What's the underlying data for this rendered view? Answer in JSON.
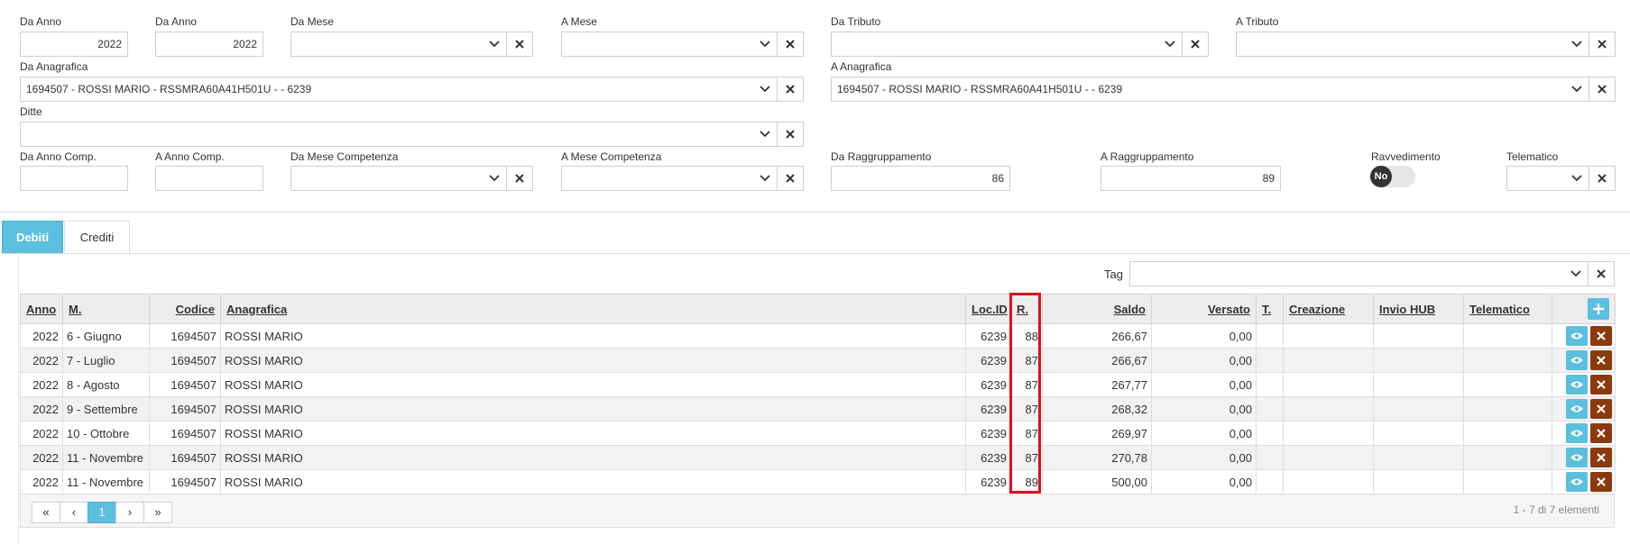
{
  "filters": {
    "da_anno": {
      "label": "Da Anno",
      "value": "2022"
    },
    "a_anno": {
      "label": "Da Anno",
      "value": "2022"
    },
    "da_mese": {
      "label": "Da Mese",
      "value": ""
    },
    "a_mese": {
      "label": "A Mese",
      "value": ""
    },
    "da_tributo": {
      "label": "Da Tributo",
      "value": ""
    },
    "a_tributo": {
      "label": "A Tributo",
      "value": ""
    },
    "da_anagrafica": {
      "label": "Da Anagrafica",
      "value": "1694507 - ROSSI MARIO - RSSMRA60A41H501U - - 6239"
    },
    "a_anagrafica": {
      "label": "A Anagrafica",
      "value": "1694507 - ROSSI MARIO - RSSMRA60A41H501U - - 6239"
    },
    "ditte": {
      "label": "Ditte",
      "value": ""
    },
    "da_anno_comp": {
      "label": "Da Anno Comp.",
      "value": ""
    },
    "a_anno_comp": {
      "label": "A Anno Comp.",
      "value": ""
    },
    "da_mese_comp": {
      "label": "Da Mese Competenza",
      "value": ""
    },
    "a_mese_comp": {
      "label": "A Mese Competenza",
      "value": ""
    },
    "da_raggruppamento": {
      "label": "Da Raggruppamento",
      "value": "86"
    },
    "a_raggruppamento": {
      "label": "A Raggruppamento",
      "value": "89"
    },
    "ravvedimento": {
      "label": "Ravvedimento",
      "toggle_text": "No"
    },
    "telematico": {
      "label": "Telematico",
      "value": ""
    }
  },
  "tabs": [
    {
      "label": "Debiti",
      "active": true
    },
    {
      "label": "Crediti",
      "active": false
    }
  ],
  "tag": {
    "label": "Tag",
    "value": ""
  },
  "table": {
    "headers": {
      "anno": "Anno",
      "mese": "M.",
      "codice": "Codice",
      "anagrafica": "Anagrafica",
      "locid": "Loc.ID",
      "r": "R.",
      "saldo": "Saldo",
      "versato": "Versato",
      "t": "T.",
      "creazione": "Creazione",
      "invio_hub": "Invio HUB",
      "telematico": "Telematico"
    },
    "rows": [
      {
        "anno": "2022",
        "mese": "6 - Giugno",
        "codice": "1694507",
        "anagrafica": "ROSSI MARIO",
        "locid": "6239",
        "r": "88",
        "saldo": "266,67",
        "versato": "0,00"
      },
      {
        "anno": "2022",
        "mese": "7 - Luglio",
        "codice": "1694507",
        "anagrafica": "ROSSI MARIO",
        "locid": "6239",
        "r": "87",
        "saldo": "266,67",
        "versato": "0,00"
      },
      {
        "anno": "2022",
        "mese": "8 - Agosto",
        "codice": "1694507",
        "anagrafica": "ROSSI MARIO",
        "locid": "6239",
        "r": "87",
        "saldo": "267,77",
        "versato": "0,00"
      },
      {
        "anno": "2022",
        "mese": "9 - Settembre",
        "codice": "1694507",
        "anagrafica": "ROSSI MARIO",
        "locid": "6239",
        "r": "87",
        "saldo": "268,32",
        "versato": "0,00"
      },
      {
        "anno": "2022",
        "mese": "10 - Ottobre",
        "codice": "1694507",
        "anagrafica": "ROSSI MARIO",
        "locid": "6239",
        "r": "87",
        "saldo": "269,97",
        "versato": "0,00"
      },
      {
        "anno": "2022",
        "mese": "11 - Novembre",
        "codice": "1694507",
        "anagrafica": "ROSSI MARIO",
        "locid": "6239",
        "r": "87",
        "saldo": "270,78",
        "versato": "0,00"
      },
      {
        "anno": "2022",
        "mese": "11 - Novembre",
        "codice": "1694507",
        "anagrafica": "ROSSI MARIO",
        "locid": "6239",
        "r": "89",
        "saldo": "500,00",
        "versato": "0,00"
      }
    ]
  },
  "pager": {
    "first": "«",
    "prev": "‹",
    "current": "1",
    "next": "›",
    "last": "»",
    "info": "1 - 7 di 7 elementi"
  },
  "icons": {
    "chevron": "chevron-down-icon",
    "clear": "close-icon",
    "view": "eye-icon",
    "delete": "close-icon",
    "add": "plus-icon"
  },
  "colors": {
    "accent": "#5bc0de",
    "delete": "#8b3a0e",
    "highlight": "#e0101f"
  }
}
